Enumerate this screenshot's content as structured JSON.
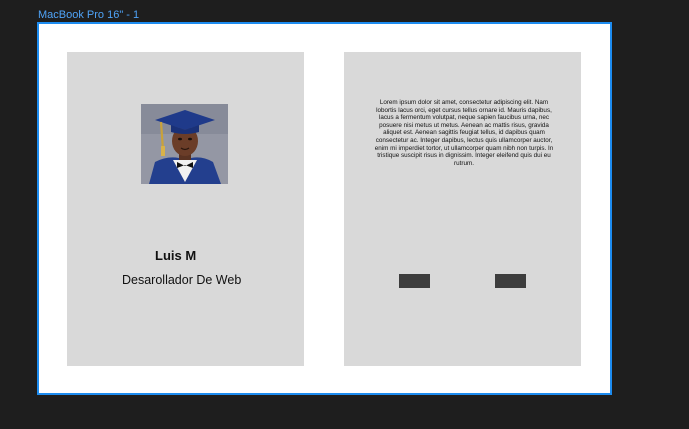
{
  "frame": {
    "label": "MacBook Pro 16\" - 1"
  },
  "profile": {
    "name": "Luis M",
    "role": "Desarollador De Web"
  },
  "about": {
    "text": "Lorem ipsum dolor sit amet, consectetur adipiscing elit. Nam lobortis lacus orci, eget cursus tellus ornare id. Mauris dapibus, lacus a fermentum volutpat, neque sapien faucibus urna, nec posuere nisi metus ut metus. Aenean ac mattis risus, gravida aliquet est. Aenean sagittis feugiat tellus, id dapibus quam consectetur ac. Integer dapibus, lectus quis ullamcorper auctor, enim mi imperdiet tortor, ut ullamcorper quam nibh non turpis. In tristique suscipit risus in dignissim. Integer eleifend quis dui eu rutrum."
  },
  "colors": {
    "canvas": "#1e1e1e",
    "frame_border": "#1d8cf0",
    "card": "#d9d9d9",
    "button": "#3d3d3d"
  }
}
